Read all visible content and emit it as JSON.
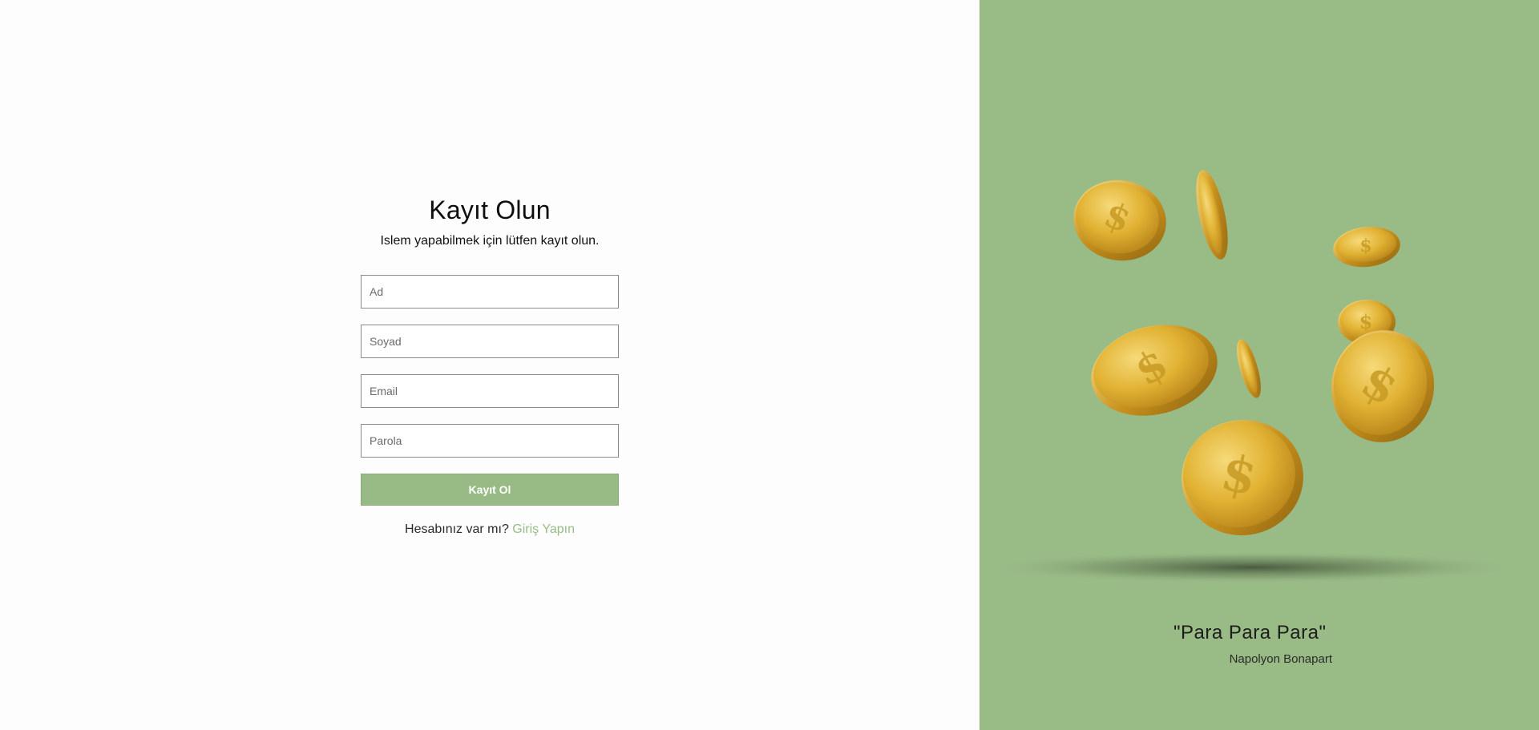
{
  "form": {
    "title": "Kayıt Olun",
    "subtitle": "Islem yapabilmek için lütfen kayıt olun.",
    "fields": [
      {
        "placeholder": "Ad",
        "value": ""
      },
      {
        "placeholder": "Soyad",
        "value": ""
      },
      {
        "placeholder": "Email",
        "value": ""
      },
      {
        "placeholder": "Parola",
        "value": ""
      }
    ],
    "submit_label": "Kayıt Ol",
    "login_prompt": "Hesabınız var mı?",
    "login_link": "Giriş Yapın"
  },
  "panel": {
    "quote": "\"Para Para Para\"",
    "author": "Napolyon Bonapart",
    "image_subject": "falling-gold-dollar-coins"
  },
  "colors": {
    "accent_green": "#99bb86",
    "link_green": "#98bb86",
    "coin_gold": "#e3b632",
    "background": "#fdfdfd"
  }
}
